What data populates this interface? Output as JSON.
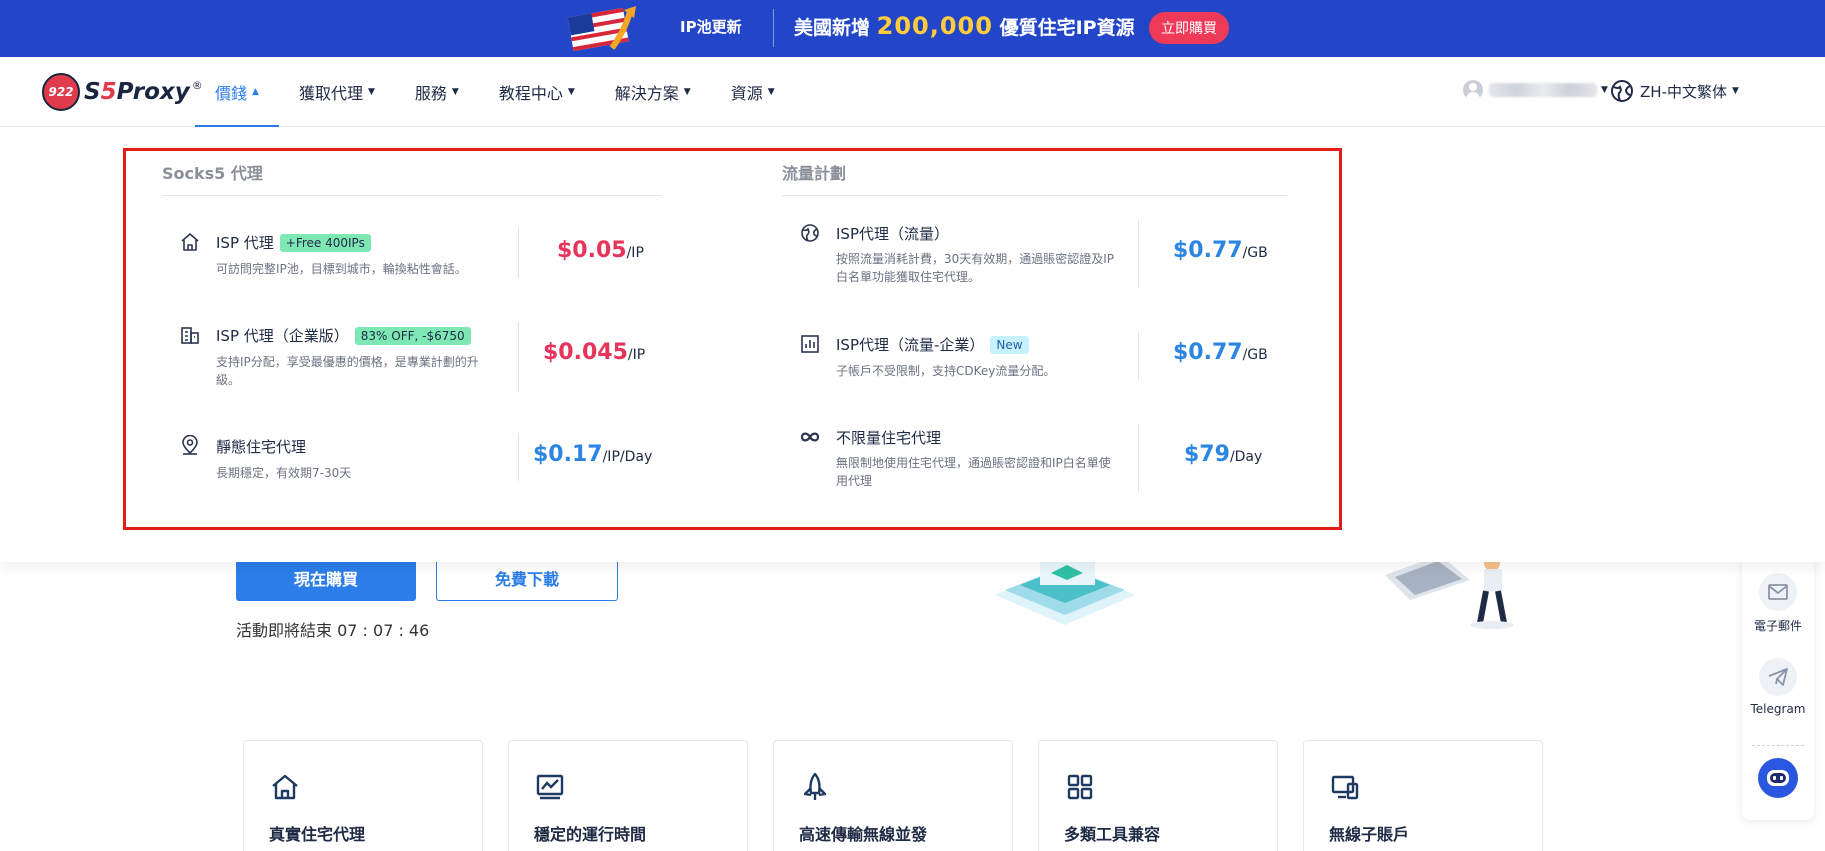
{
  "banner": {
    "tag": "IP池更新",
    "headline_prefix": "美國新增",
    "headline_number": "200,000",
    "headline_suffix": "優質住宅IP資源",
    "cta": "立即購買"
  },
  "nav": {
    "logo_badge": "922",
    "logo_text_a": "S",
    "logo_text_five": "5",
    "logo_text_b": "Proxy",
    "logo_reg": "®",
    "items": [
      {
        "label": "價錢",
        "active": true
      },
      {
        "label": "獲取代理"
      },
      {
        "label": "服務"
      },
      {
        "label": "教程中心"
      },
      {
        "label": "解決方案"
      },
      {
        "label": "資源"
      }
    ],
    "language": "ZH-中文繁体"
  },
  "dropdown": {
    "left_title": "Socks5 代理",
    "right_title": "流量計劃",
    "left": [
      {
        "icon": "home-icon",
        "name": "ISP 代理",
        "badge": "+Free 400IPs",
        "desc": "可訪問完整IP池，目標到城市，輪換粘性會話。",
        "price": "$0.05",
        "unit": "/IP",
        "price_color": "#e8335a"
      },
      {
        "icon": "building-icon",
        "name": "ISP 代理（企業版）",
        "badge": "83% OFF, -$6750",
        "desc": "支持IP分配，享受最優惠的價格，是專業計劃的升級。",
        "price": "$0.045",
        "unit": "/IP",
        "price_color": "#e8335a"
      },
      {
        "icon": "location-pin-icon",
        "name": "靜態住宅代理",
        "badge": "",
        "desc": "長期穩定，有效期7-30天",
        "price": "$0.17",
        "unit": "/IP/Day",
        "price_color": "#2b86e3"
      }
    ],
    "right": [
      {
        "icon": "globe-icon",
        "name": "ISP代理（流量）",
        "badge": "",
        "desc": "按照流量消耗計費，30天有效期，通過賬密認證及IP白名單功能獲取住宅代理。",
        "price": "$0.77",
        "unit": "/GB",
        "price_color": "#2b86e3"
      },
      {
        "icon": "bar-chart-icon",
        "name": "ISP代理（流量-企業）",
        "badge": "New",
        "desc": "子帳戶不受限制，支持CDKey流量分配。",
        "price": "$0.77",
        "unit": "/GB",
        "price_color": "#2b86e3"
      },
      {
        "icon": "infinity-icon",
        "name": "不限量住宅代理",
        "badge": "",
        "desc": "無限制地使用住宅代理，通過賬密認證和IP白名單使用代理",
        "price": "$79",
        "unit": "/Day",
        "price_color": "#2b86e3"
      }
    ]
  },
  "hero": {
    "buy_label": "現在購買",
    "download_label": "免費下載",
    "countdown": "活動即將結束 07 : 07 : 46"
  },
  "features": [
    {
      "icon": "home-icon",
      "title": "真實住宅代理"
    },
    {
      "icon": "line-chart-icon",
      "title": "穩定的運行時間"
    },
    {
      "icon": "rocket-icon",
      "title": "高速傳輸無線並發"
    },
    {
      "icon": "grid-icon",
      "title": "多類工具兼容"
    },
    {
      "icon": "devices-icon",
      "title": "無線子賬戶"
    }
  ],
  "sidebar": {
    "email": "電子郵件",
    "telegram": "Telegram"
  }
}
